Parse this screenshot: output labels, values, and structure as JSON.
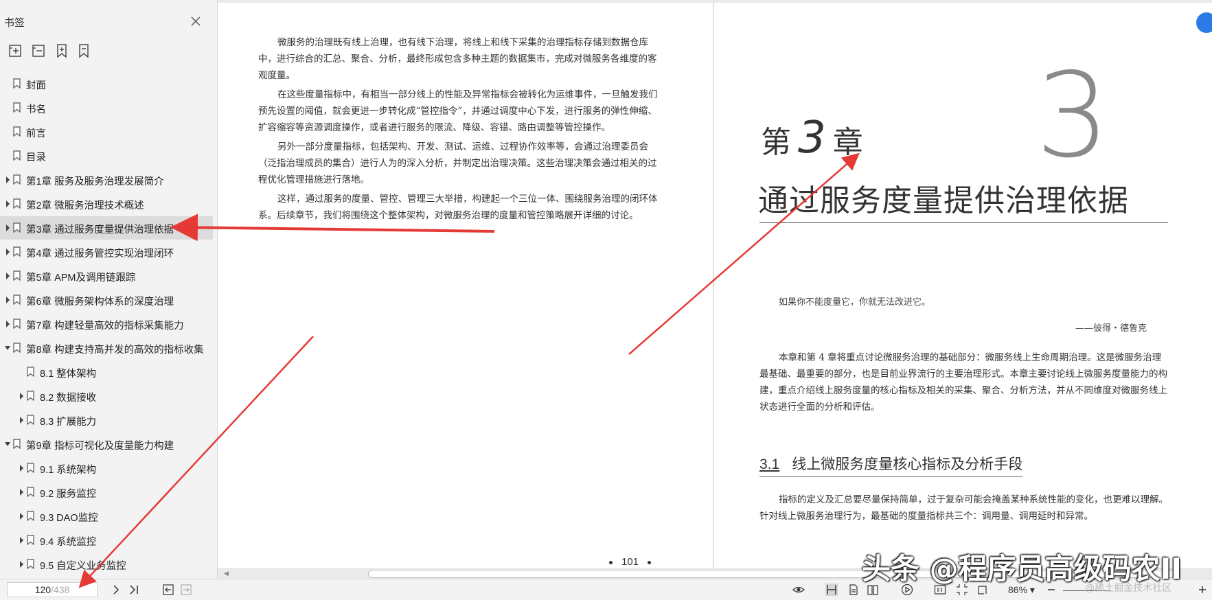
{
  "sidebar": {
    "title": "书签",
    "toolbar": [
      "expand-all-icon",
      "collapse-all-icon",
      "add-bookmark-icon",
      "bookmark-icon"
    ],
    "items": [
      {
        "label": "封面",
        "level": 0,
        "expandable": false
      },
      {
        "label": "书名",
        "level": 0,
        "expandable": false
      },
      {
        "label": "前言",
        "level": 0,
        "expandable": false
      },
      {
        "label": "目录",
        "level": 0,
        "expandable": false
      },
      {
        "label": "第1章 服务及服务治理发展简介",
        "level": 0,
        "expandable": true,
        "expanded": false
      },
      {
        "label": "第2章 微服务治理技术概述",
        "level": 0,
        "expandable": true,
        "expanded": false
      },
      {
        "label": "第3章 通过服务度量提供治理依据",
        "level": 0,
        "expandable": true,
        "expanded": false,
        "selected": true
      },
      {
        "label": "第4章 通过服务管控实现治理闭环",
        "level": 0,
        "expandable": true,
        "expanded": false
      },
      {
        "label": "第5章 APM及调用链跟踪",
        "level": 0,
        "expandable": true,
        "expanded": false
      },
      {
        "label": "第6章 微服务架构体系的深度治理",
        "level": 0,
        "expandable": true,
        "expanded": false
      },
      {
        "label": "第7章 构建轻量高效的指标采集能力",
        "level": 0,
        "expandable": true,
        "expanded": false
      },
      {
        "label": "第8章 构建支持高并发的高效的指标收集",
        "level": 0,
        "expandable": true,
        "expanded": true
      },
      {
        "label": "8.1 整体架构",
        "level": 1,
        "expandable": false
      },
      {
        "label": "8.2 数据接收",
        "level": 1,
        "expandable": true,
        "expanded": false
      },
      {
        "label": "8.3 扩展能力",
        "level": 1,
        "expandable": true,
        "expanded": false
      },
      {
        "label": "第9章 指标可视化及度量能力构建",
        "level": 0,
        "expandable": true,
        "expanded": true
      },
      {
        "label": "9.1 系统架构",
        "level": 1,
        "expandable": true,
        "expanded": false
      },
      {
        "label": "9.2 服务监控",
        "level": 1,
        "expandable": true,
        "expanded": false
      },
      {
        "label": "9.3 DAO监控",
        "level": 1,
        "expandable": true,
        "expanded": false
      },
      {
        "label": "9.4 系统监控",
        "level": 1,
        "expandable": true,
        "expanded": false
      },
      {
        "label": "9.5 自定义业务监控",
        "level": 1,
        "expandable": true,
        "expanded": false
      }
    ]
  },
  "left_page": {
    "paragraphs": [
      "微服务的治理既有线上治理，也有线下治理，将线上和线下采集的治理指标存储到数据仓库中，进行综合的汇总、聚合、分析，最终形成包含多种主题的数据集市，完成对微服务各维度的客观度量。",
      "在这些度量指标中，有相当一部分线上的性能及异常指标会被转化为运维事件，一旦触发我们预先设置的阈值，就会更进一步转化成“管控指令”，并通过调度中心下发，进行服务的弹性伸缩、扩容缩容等资源调度操作，或者进行服务的限流、降级、容错、路由调整等管控操作。",
      "另外一部分度量指标，包括架构、开发、测试、运维、过程协作效率等，会通过治理委员会（泛指治理成员的集合）进行人为的深入分析，并制定出治理决策。这些治理决策会通过相关的过程优化管理措施进行落地。",
      "这样，通过服务的度量、管控、管理三大举措，构建起一个三位一体、围绕服务治理的闭环体系。后续章节，我们将围绕这个整体架构，对微服务治理的度量和管控策略展开详细的讨论。"
    ],
    "page_number": "101"
  },
  "right_page": {
    "chapter_big_number": "3",
    "chapter_prefix": "第",
    "chapter_number": "3",
    "chapter_suffix": "章",
    "chapter_title": "通过服务度量提供治理依据",
    "quote": "如果你不能度量它，你就无法改进它。",
    "quote_author": "——彼得・德鲁克",
    "intro": "本章和第 4 章将重点讨论微服务治理的基础部分：微服务线上生命周期治理。这是微服务治理最基础、最重要的部分，也是目前业界流行的主要治理形式。本章主要讨论线上微服务度量能力的构建，重点介绍线上服务度量的核心指标及相关的采集、聚合、分析方法，并从不同维度对微服务线上状态进行全面的分析和评估。",
    "section_number": "3.1",
    "section_title": "线上微服务度量核心指标及分析手段",
    "section_text": "指标的定义及汇总要尽量保持简单，过于复杂可能会掩盖某种系统性能的变化，也更难以理解。针对线上微服务治理行为，最基础的度量指标共三个：调用量、调用延时和异常。"
  },
  "statusbar": {
    "current_page": "120",
    "total_pages": "/438",
    "zoom": "86%"
  },
  "watermark": "头条 @程序员高级码农II",
  "watermark_small": "@稀土掘金技术社区",
  "colors": {
    "arrow": "#e53935",
    "selected": "#dcdcdc",
    "accent": "#2b7be6"
  }
}
